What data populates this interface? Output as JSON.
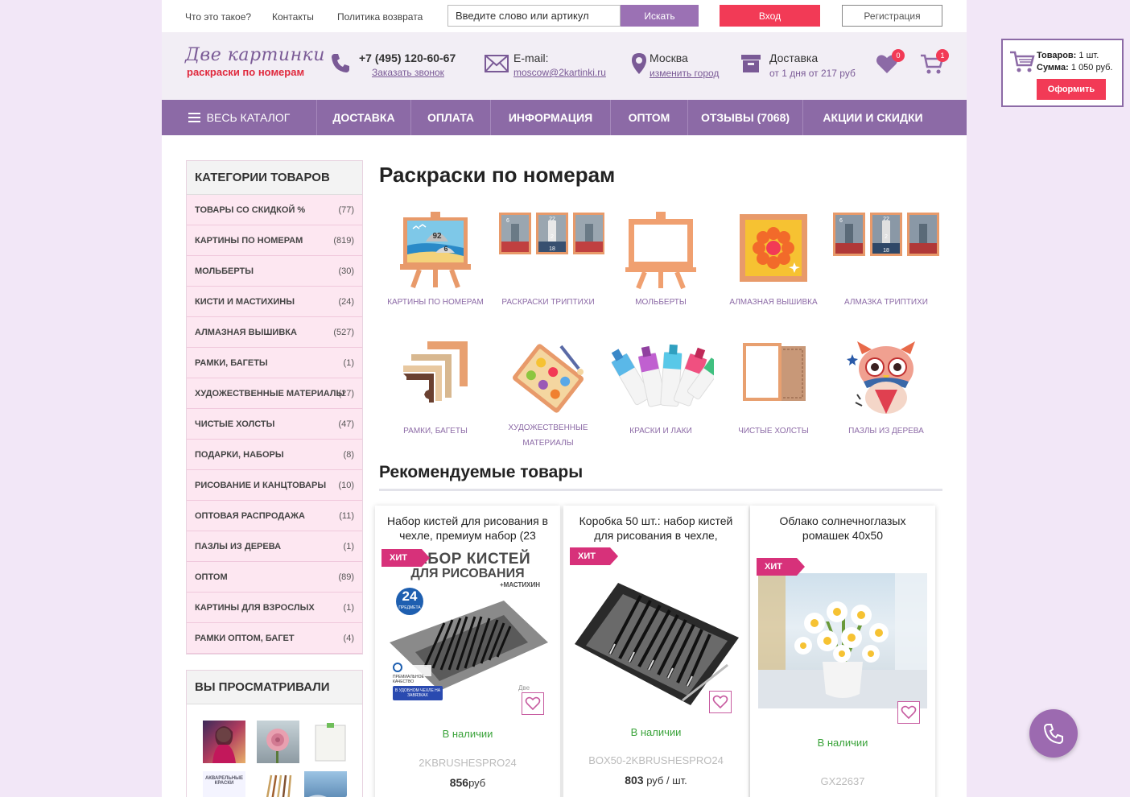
{
  "topbar": {
    "links": [
      "Что это такое?",
      "Контакты",
      "Политика возврата"
    ],
    "search_placeholder": "Введите слово или артикул",
    "search_button": "Искать",
    "login_button": "Вход",
    "register_button": "Регистрация"
  },
  "header": {
    "logo_main": "Две картинки",
    "logo_sub": "раскраски  по номерам",
    "phone": "+7 (495) 120-60-67",
    "callback_link": "Заказать звонок",
    "email_label": "E-mail:",
    "email_value": "moscow@2kartinki.ru",
    "city": "Москва",
    "change_city": "изменить город",
    "delivery_label": "Доставка",
    "delivery_value": "от 1 дня от 217 руб",
    "wishlist_count": "0",
    "cart_count": "1",
    "colors": {
      "accent": "#8c6aa6",
      "red": "#f23a56",
      "background": "#f2e7f7"
    }
  },
  "nav": {
    "items": [
      "ВЕСЬ КАТАЛОГ",
      "ДОСТАВКА",
      "ОПЛАТА",
      "ИНФОРМАЦИЯ",
      "ОПТОМ",
      "ОТЗЫВЫ (7068)",
      "АКЦИИ И СКИДКИ"
    ]
  },
  "sidebar": {
    "categories_title": "КАТЕГОРИИ ТОВАРОВ",
    "categories": [
      {
        "label": "ТОВАРЫ СО СКИДКОЙ %",
        "count": "(77)"
      },
      {
        "label": "КАРТИНЫ ПО НОМЕРАМ",
        "count": "(819)"
      },
      {
        "label": "МОЛЬБЕРТЫ",
        "count": "(30)"
      },
      {
        "label": "КИСТИ И МАСТИХИНЫ",
        "count": "(24)"
      },
      {
        "label": "АЛМАЗНАЯ ВЫШИВКА",
        "count": "(527)"
      },
      {
        "label": "РАМКИ, БАГЕТЫ",
        "count": "(1)"
      },
      {
        "label": "ХУДОЖЕСТВЕННЫЕ МАТЕРИАЛЫ",
        "count": "(27)"
      },
      {
        "label": "ЧИСТЫЕ ХОЛСТЫ",
        "count": "(47)"
      },
      {
        "label": "ПОДАРКИ, НАБОРЫ",
        "count": "(8)"
      },
      {
        "label": "РИСОВАНИЕ И КАНЦТОВАРЫ",
        "count": "(10)"
      },
      {
        "label": "ОПТОВАЯ РАСПРОДАЖА",
        "count": "(11)"
      },
      {
        "label": "ПАЗЛЫ ИЗ ДЕРЕВА",
        "count": "(1)"
      },
      {
        "label": "ОПТОМ",
        "count": "(89)"
      },
      {
        "label": "КАРТИНЫ ДЛЯ ВЗРОСЛЫХ",
        "count": "(1)"
      },
      {
        "label": "РАМКИ ОПТОМ, БАГЕТ",
        "count": "(4)"
      }
    ],
    "viewed_title": "ВЫ ПРОСМАТРИВАЛИ",
    "viewed_thumb_text": "АКВАРЕЛЬНЫЕ КРАСКИ"
  },
  "main": {
    "title": "Раскраски по номерам",
    "tiles": [
      {
        "label": "КАРТИНЫ ПО НОМЕРАМ",
        "icon": "easel-seascape-icon",
        "numbers": [
          "92",
          "6"
        ]
      },
      {
        "label": "РАСКРАСКИ ТРИПТИХИ",
        "icon": "triptych-icon",
        "numbers": [
          "22",
          "2",
          "18",
          "6"
        ]
      },
      {
        "label": "МОЛЬБЕРТЫ",
        "icon": "easel-icon"
      },
      {
        "label": "АЛМАЗНАЯ ВЫШИВКА",
        "icon": "diamond-flower-icon"
      },
      {
        "label": "АЛМАЗКА ТРИПТИХИ",
        "icon": "diamond-triptych-icon",
        "numbers": [
          "22",
          "2",
          "18",
          "6"
        ]
      },
      {
        "label": "РАМКИ, БАГЕТЫ",
        "icon": "frames-icon"
      },
      {
        "label": "ХУДОЖЕСТВЕННЫЕ МАТЕРИАЛЫ",
        "icon": "palette-icon"
      },
      {
        "label": "КРАСКИ И ЛАКИ",
        "icon": "paint-tubes-icon"
      },
      {
        "label": "ЧИСТЫЕ ХОЛСТЫ",
        "icon": "canvas-icon"
      },
      {
        "label": "ПАЗЛЫ ИЗ ДЕРЕВА",
        "icon": "owl-puzzle-icon"
      }
    ],
    "recommended_title": "Рекомендуемые товары",
    "products": [
      {
        "title": "Набор кистей для рисования в чехле, премиум набор (23",
        "badge": "ХИТ",
        "img_heading_1": "НАБОР КИСТЕЙ",
        "img_heading_2": "ДЛЯ РИСОВАНИЯ",
        "img_heading_3": "+МАСТИХИН",
        "img_number": "24",
        "img_number_sub": "ПРЕДМЕТА",
        "img_quality": "ПРЕМИАЛЬНОЕ КАЧЕСТВО",
        "img_case": "В УДОБНОМ ЧЕХЛЕ НА ЗАВЯЗКАХ",
        "img_brand": "Две",
        "stock": "В наличии",
        "sku": "2KBRUSHESPRO24",
        "price_value": "856",
        "price_unit": "руб"
      },
      {
        "title": "Коробка 50 шт.: набор кистей для рисования в чехле,",
        "badge": "ХИТ",
        "stock": "В наличии",
        "sku": "BOX50-2KBRUSHESPRO24",
        "price_value": "803",
        "price_unit": "руб / шт."
      },
      {
        "title": "Облако солнечноглазых ромашек 40х50",
        "badge": "ХИТ",
        "stock": "В наличии",
        "sku": "GX22637"
      }
    ]
  },
  "floating_cart": {
    "items_label": "Товаров:",
    "items_value": "1 шт.",
    "sum_label": "Сумма:",
    "sum_value": "1 050 руб.",
    "checkout_button": "Оформить"
  }
}
